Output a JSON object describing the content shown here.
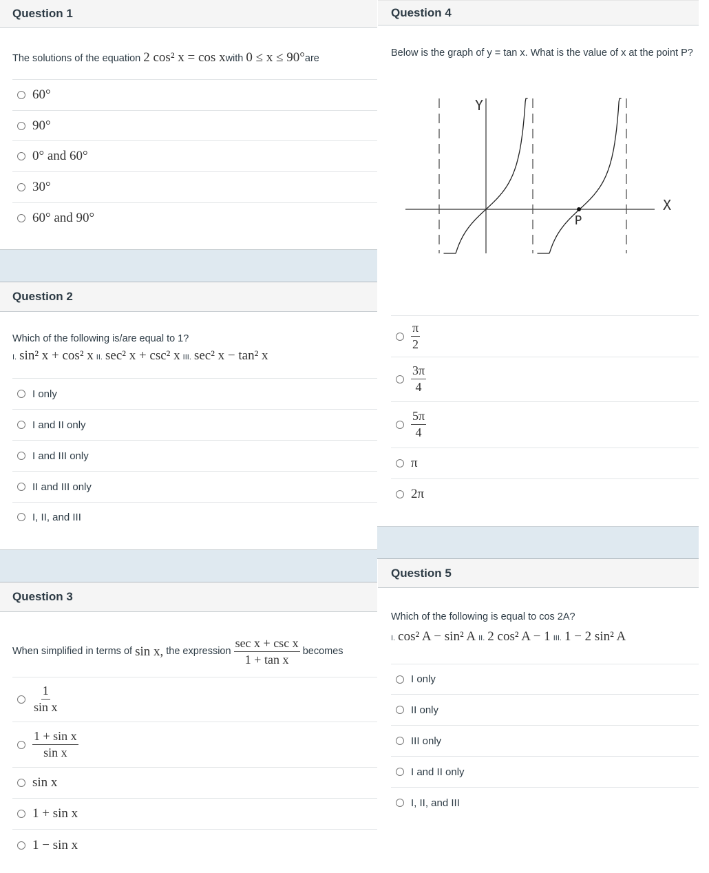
{
  "questions": {
    "q1": {
      "title": "Question 1",
      "text_prefix": "The solutions of the equation",
      "equation": "2 cos² x = cos x",
      "text_mid": "with",
      "range": "0 ≤ x ≤ 90°",
      "text_suffix": "are",
      "answers": [
        {
          "label": "60°"
        },
        {
          "label": "90°"
        },
        {
          "label": "0° and 60°"
        },
        {
          "label": "30°"
        },
        {
          "label": "60° and 90°"
        }
      ]
    },
    "q2": {
      "title": "Question 2",
      "text": "Which of the following is/are equal to 1?",
      "items": [
        {
          "numeral": "I.",
          "expr": "sin² x + cos² x"
        },
        {
          "numeral": "II.",
          "expr": "sec² x + csc² x"
        },
        {
          "numeral": "III.",
          "expr": "sec² x − tan² x"
        }
      ],
      "answers": [
        {
          "label": "I only"
        },
        {
          "label": "I and II only"
        },
        {
          "label": "I and III only"
        },
        {
          "label": "II and III only"
        },
        {
          "label": "I, II, and III"
        }
      ]
    },
    "q3": {
      "title": "Question 3",
      "text_prefix": "When simplified in terms of",
      "in_terms_of": "sin x,",
      "text_mid": "the expression",
      "expr_num": "sec x + csc x",
      "expr_den": "1 + tan x",
      "text_suffix": "becomes",
      "answers": [
        {
          "num": "1",
          "den": "sin x"
        },
        {
          "num": "1 + sin x",
          "den": "sin x"
        },
        {
          "label": "sin x"
        },
        {
          "label": "1 + sin x"
        },
        {
          "label": "1 − sin x"
        }
      ]
    },
    "q4": {
      "title": "Question 4",
      "text": "Below is the graph of y = tan x. What is the value of x at the point P?",
      "graph": {
        "y_label": "Y",
        "x_label": "X",
        "point_label": "P"
      },
      "answers": [
        {
          "num": "π",
          "den": "2"
        },
        {
          "num": "3π",
          "den": "4"
        },
        {
          "num": "5π",
          "den": "4"
        },
        {
          "label": "π"
        },
        {
          "label": "2π"
        }
      ]
    },
    "q5": {
      "title": "Question 5",
      "text": "Which of the following is equal to cos 2A?",
      "items": [
        {
          "numeral": "I.",
          "expr": "cos² A − sin² A"
        },
        {
          "numeral": "II.",
          "expr": "2 cos² A − 1"
        },
        {
          "numeral": "III.",
          "expr": "1 − 2 sin² A"
        }
      ],
      "answers": [
        {
          "label": "I only"
        },
        {
          "label": "II only"
        },
        {
          "label": "III only"
        },
        {
          "label": "I and II only"
        },
        {
          "label": "I, II, and III"
        }
      ]
    }
  }
}
